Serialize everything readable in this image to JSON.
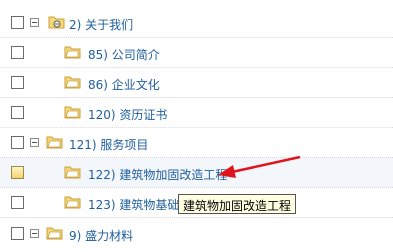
{
  "tree": {
    "rows": [
      {
        "label": "2) 关于我们",
        "level": 1,
        "expanded": true,
        "selected": false
      },
      {
        "label": "85) 公司简介",
        "level": 2,
        "selected": false
      },
      {
        "label": "86) 企业文化",
        "level": 2,
        "selected": false
      },
      {
        "label": "120) 资历证书",
        "level": 2,
        "selected": false
      },
      {
        "label": "121) 服务项目",
        "level": 1,
        "expanded": true,
        "selected": false
      },
      {
        "label": "122) 建筑物加固改造工程",
        "level": 2,
        "selected": true
      },
      {
        "label": "123) 建筑物基础",
        "level": 2,
        "selected": false
      },
      {
        "label": "9) 盛力材料",
        "level": 1,
        "expanded": true,
        "selected": false
      }
    ]
  },
  "tooltip": {
    "text": "建筑物加固改造工程"
  },
  "colors": {
    "link": "#1f5e9e",
    "arrow": "#e0141c",
    "tooltip_bg": "#ffffe1",
    "folder": "#f5d77a"
  }
}
